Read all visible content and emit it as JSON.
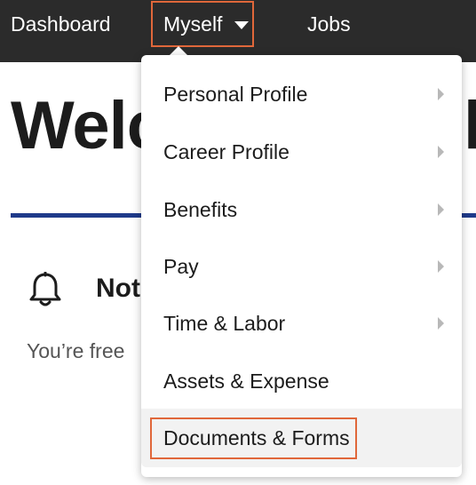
{
  "nav": {
    "dashboard": "Dashboard",
    "myself": "Myself",
    "jobs": "Jobs"
  },
  "page": {
    "welcome_visible": "Welc",
    "welcome_tail": "l",
    "notifications_title": "Not",
    "notifications_text": "You’re free"
  },
  "menu": {
    "items": [
      {
        "label": "Personal Profile",
        "has_submenu": true
      },
      {
        "label": "Career Profile",
        "has_submenu": true
      },
      {
        "label": "Benefits",
        "has_submenu": true
      },
      {
        "label": "Pay",
        "has_submenu": true
      },
      {
        "label": "Time & Labor",
        "has_submenu": true
      },
      {
        "label": "Assets & Expense",
        "has_submenu": false
      },
      {
        "label": "Documents & Forms",
        "has_submenu": false,
        "highlighted": true
      }
    ]
  },
  "colors": {
    "nav_background": "#2b2b2b",
    "highlight_outline": "#e0673a",
    "divider": "#1f3a8a"
  },
  "icons": {
    "dropdown_caret": "caret-down-icon",
    "submenu": "chevron-right-icon",
    "notifications": "bell-icon"
  }
}
